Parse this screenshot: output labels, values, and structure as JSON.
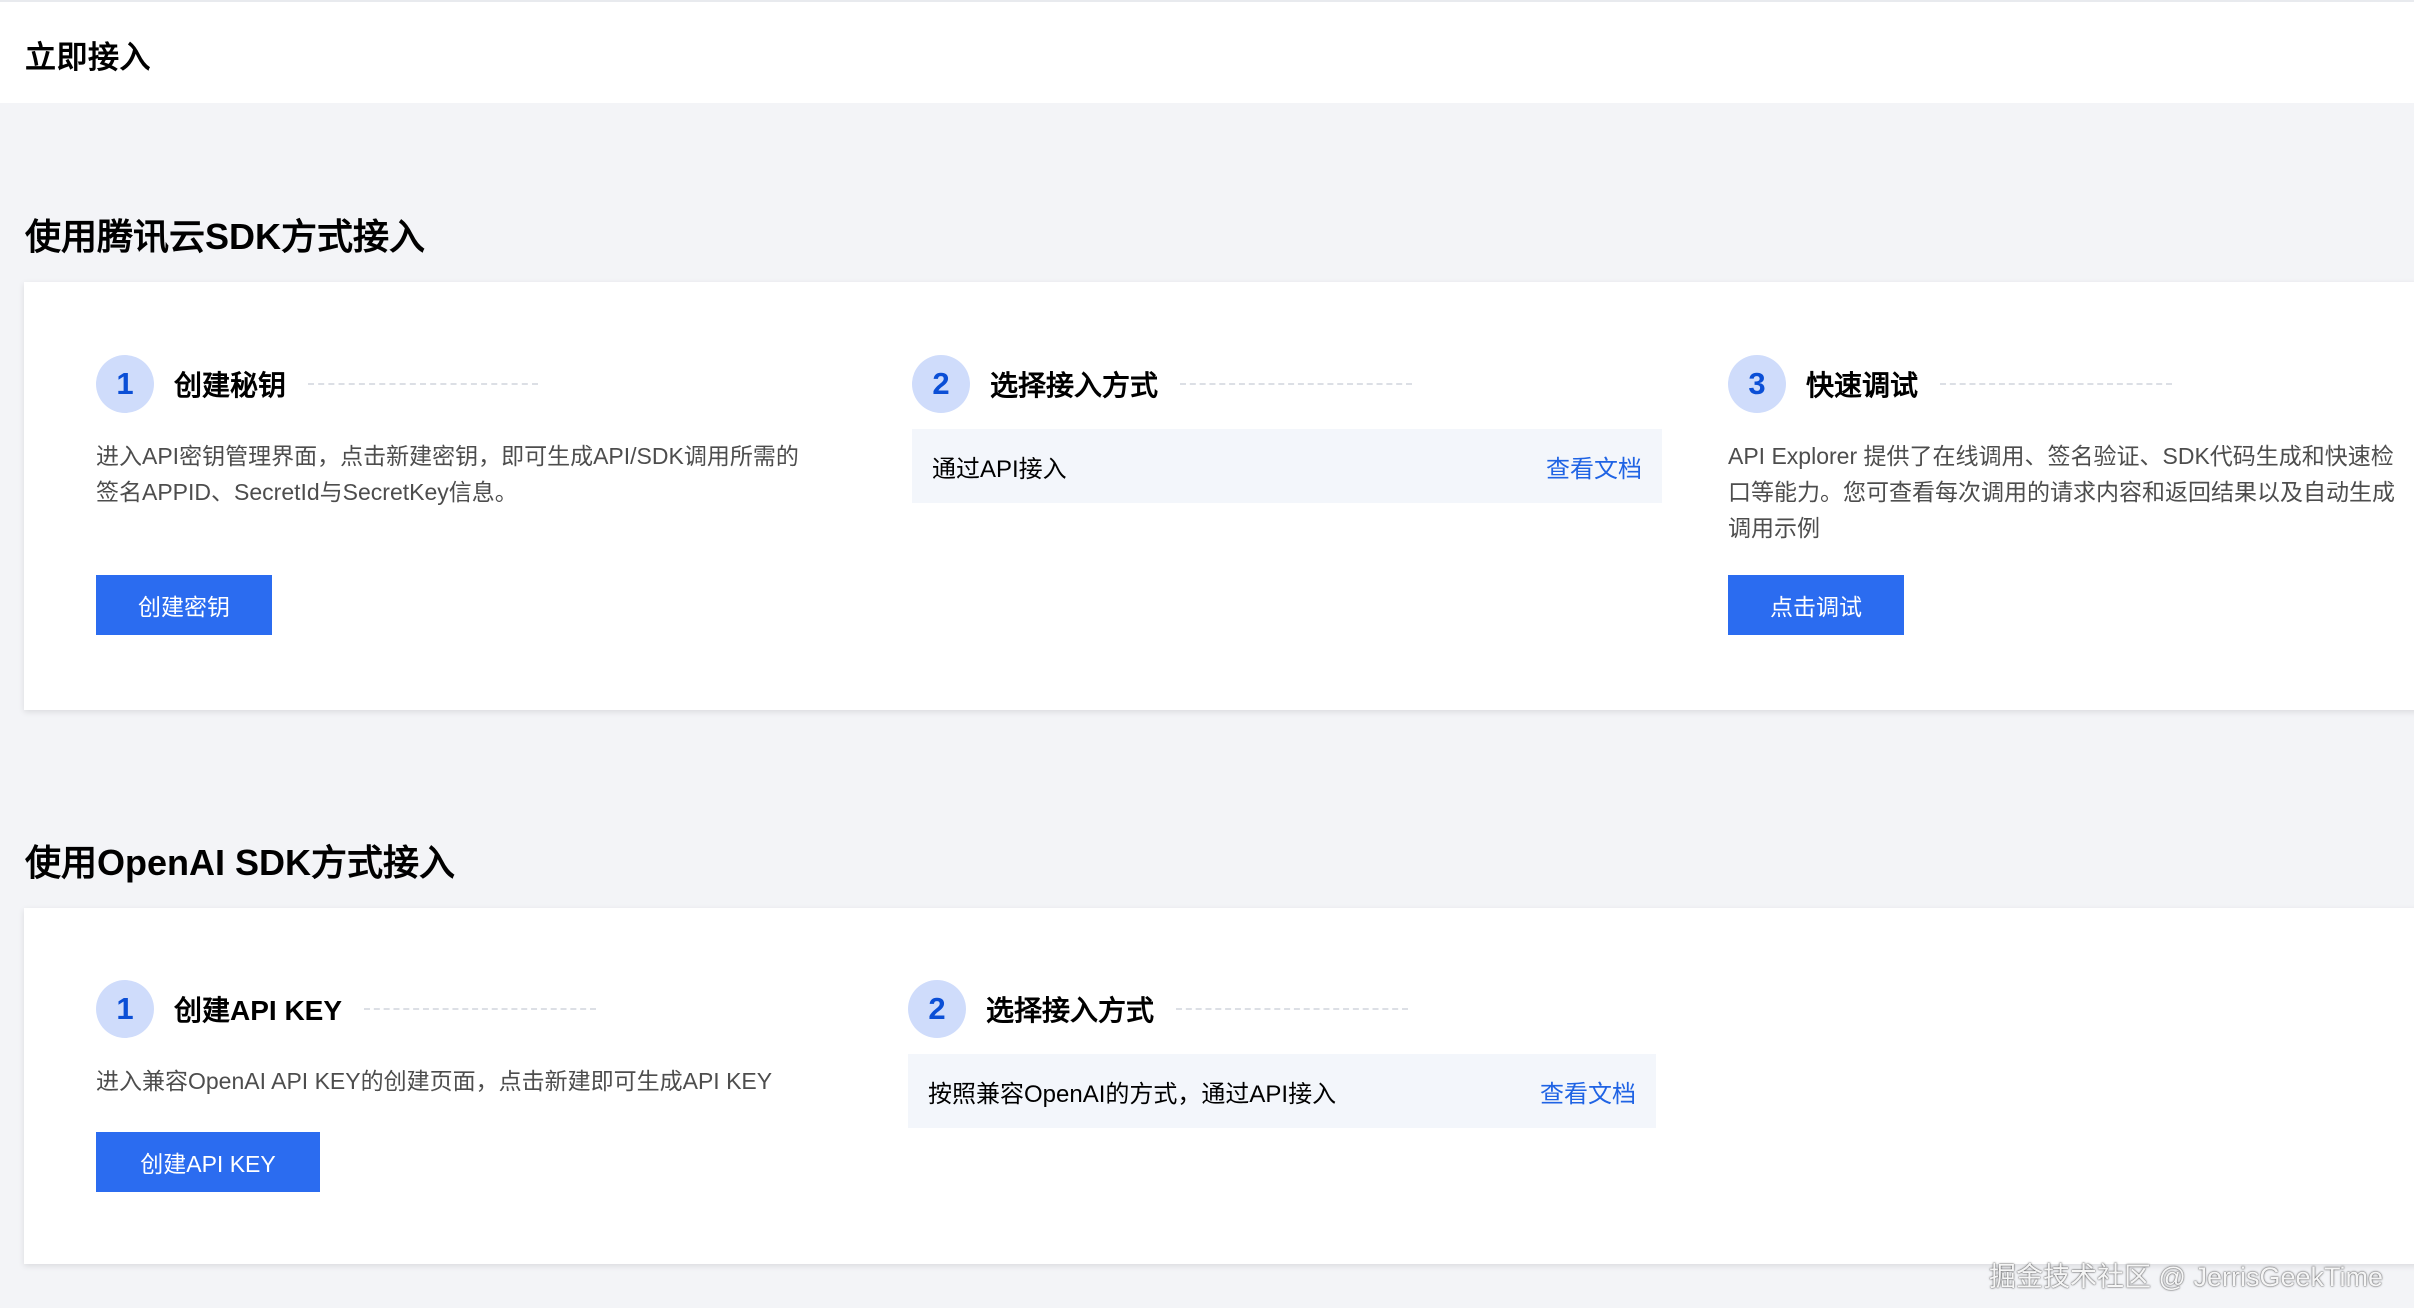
{
  "header": {
    "title": "立即接入"
  },
  "tencent_section": {
    "title": "使用腾讯云SDK方式接入",
    "steps": [
      {
        "number": "1",
        "title": "创建秘钥",
        "description_line1": "进入API密钥管理界面，点击新建密钥，即可生成API/SDK调用所需的",
        "description_line2": "签名APPID、SecretId与SecretKey信息。",
        "button_label": "创建密钥"
      },
      {
        "number": "2",
        "title": "选择接入方式",
        "access_label": "通过API接入",
        "access_link": "查看文档"
      },
      {
        "number": "3",
        "title": "快速调试",
        "description_line1": "API Explorer 提供了在线调用、签名验证、SDK代码生成和快速检",
        "description_line2": "口等能力。您可查看每次调用的请求内容和返回结果以及自动生成",
        "description_line3": "调用示例",
        "button_label": "点击调试"
      }
    ]
  },
  "openai_section": {
    "title": "使用OpenAI SDK方式接入",
    "steps": [
      {
        "number": "1",
        "title": "创建API KEY",
        "description": "进入兼容OpenAI API KEY的创建页面，点击新建即可生成API KEY",
        "button_label": "创建API KEY"
      },
      {
        "number": "2",
        "title": "选择接入方式",
        "access_label": "按照兼容OpenAI的方式，通过API接入",
        "access_link": "查看文档"
      }
    ]
  },
  "watermark": "掘金技术社区 @ JerrisGeekTime",
  "colors": {
    "primary_button": "#2b6cf0",
    "link": "#1f63e4",
    "step_badge_bg": "#cfdcfb",
    "step_badge_text": "#0b4fd6",
    "page_bg": "#f3f4f7"
  }
}
